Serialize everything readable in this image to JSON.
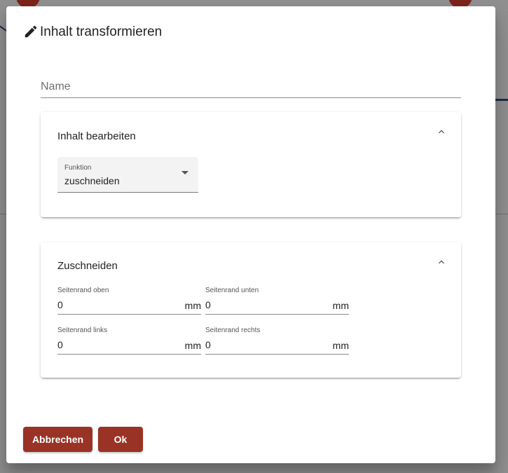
{
  "dialog": {
    "title": "Inhalt transformieren",
    "title_icon": "pencil-icon"
  },
  "name_field": {
    "placeholder": "Name",
    "value": ""
  },
  "edit_panel": {
    "title": "Inhalt bearbeiten",
    "expanded": true,
    "toggle_icon": "chevron-up-icon",
    "function_select": {
      "label": "Funktion",
      "value": "zuschneiden"
    }
  },
  "crop_panel": {
    "title": "Zuschneiden",
    "expanded": true,
    "toggle_icon": "chevron-up-icon",
    "fields": {
      "top": {
        "label": "Seitenrand oben",
        "value": "0",
        "unit": "mm"
      },
      "bottom": {
        "label": "Seitenrand unten",
        "value": "0",
        "unit": "mm"
      },
      "left": {
        "label": "Seitenrand links",
        "value": "0",
        "unit": "mm"
      },
      "right": {
        "label": "Seitenrand rechts",
        "value": "0",
        "unit": "mm"
      }
    }
  },
  "actions": {
    "cancel_label": "Abbrechen",
    "ok_label": "Ok"
  },
  "colors": {
    "accent": "#993326",
    "overlay": "#8f8f8f"
  }
}
